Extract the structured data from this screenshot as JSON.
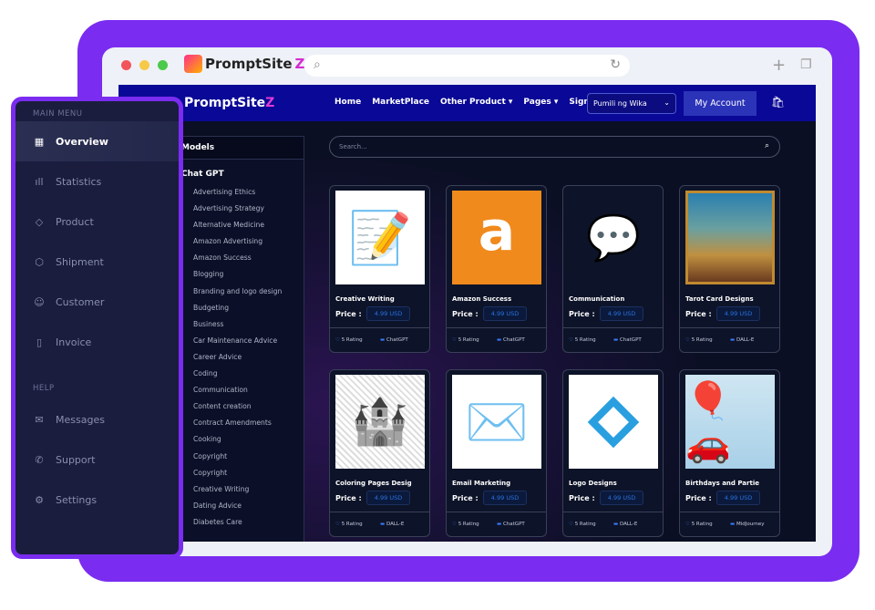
{
  "colors": {
    "accent": "#7a2cf0",
    "navbar": "#0a0896",
    "price": "#2a72e0"
  },
  "browser": {
    "brand": "PromptSite",
    "brand_z": "Z"
  },
  "nav": {
    "logo": "PromptSite",
    "logo_z": "Z",
    "links": [
      "Home",
      "MarketPlace",
      "Other Product ▾",
      "Pages ▾",
      "Sign in"
    ],
    "language": "Pumili ng Wika",
    "account": "My Account"
  },
  "categories": {
    "header": "Models",
    "group": "Chat GPT",
    "items": [
      "Advertising Ethics",
      "Advertising Strategy",
      "Alternative Medicine",
      "Amazon Advertising",
      "Amazon Success",
      "Blogging",
      "Branding and logo design",
      "Budgeting",
      "Business",
      "Car Maintenance Advice",
      "Career Advice",
      "Coding",
      "Communication",
      "Content creation",
      "Contract Amendments",
      "Cooking",
      "Copyright",
      "Copyright",
      "Creative Writing",
      "Dating Advice",
      "Diabetes Care"
    ]
  },
  "search": {
    "placeholder": "Search..."
  },
  "price_label": "Price :",
  "products": [
    {
      "title": "Creative Writing",
      "price": "4.99 USD",
      "rating": "5 Rating",
      "model": "ChatGPT",
      "icon": "writing-icon"
    },
    {
      "title": "Amazon Success",
      "price": "4.99 USD",
      "rating": "5 Rating",
      "model": "ChatGPT",
      "icon": "amazon-logo"
    },
    {
      "title": "Communication",
      "price": "4.99 USD",
      "rating": "5 Rating",
      "model": "ChatGPT",
      "icon": "communication-icon"
    },
    {
      "title": "Tarot Card Designs",
      "price": "4.99 USD",
      "rating": "5 Rating",
      "model": "DALL-E",
      "icon": "tarot-image"
    },
    {
      "title": "Coloring Pages Desig",
      "price": "4.99 USD",
      "rating": "5 Rating",
      "model": "DALL-E",
      "icon": "castle-image"
    },
    {
      "title": "Email Marketing",
      "price": "4.99 USD",
      "rating": "5 Rating",
      "model": "ChatGPT",
      "icon": "email-icon"
    },
    {
      "title": "Logo Designs",
      "price": "4.99 USD",
      "rating": "5 Rating",
      "model": "DALL-E",
      "icon": "logo-image"
    },
    {
      "title": "Birthdays and Partie",
      "price": "4.99 USD",
      "rating": "5 Rating",
      "model": "MidJourney",
      "icon": "balloons-image"
    }
  ],
  "sidebar": {
    "main_label": "MAIN MENU",
    "help_label": "HELP",
    "main": [
      {
        "label": "Overview",
        "icon": "grid-icon",
        "glyph": "▦",
        "active": true
      },
      {
        "label": "Statistics",
        "icon": "bar-chart-icon",
        "glyph": "ıll"
      },
      {
        "label": "Product",
        "icon": "tag-icon",
        "glyph": "◇"
      },
      {
        "label": "Shipment",
        "icon": "box-icon",
        "glyph": "⬡"
      },
      {
        "label": "Customer",
        "icon": "users-icon",
        "glyph": "☺"
      },
      {
        "label": "Invoice",
        "icon": "clipboard-icon",
        "glyph": "▯"
      }
    ],
    "help": [
      {
        "label": "Messages",
        "icon": "mail-icon",
        "glyph": "✉"
      },
      {
        "label": "Support",
        "icon": "phone-icon",
        "glyph": "✆"
      },
      {
        "label": "Settings",
        "icon": "gear-icon",
        "glyph": "⚙"
      }
    ]
  }
}
